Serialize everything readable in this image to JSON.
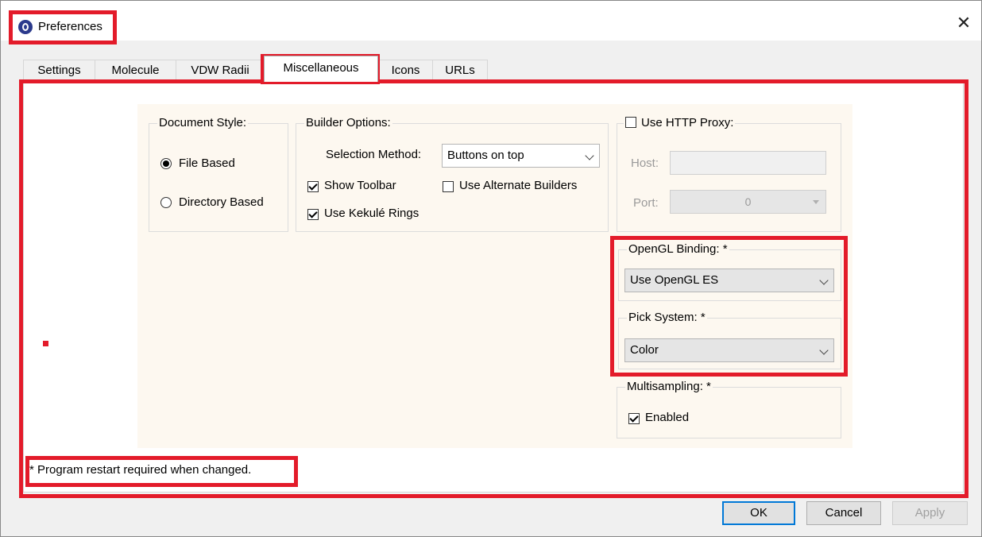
{
  "window": {
    "title": "Preferences",
    "close_glyph": "✕"
  },
  "tabs": [
    {
      "label": "Settings"
    },
    {
      "label": "Molecule"
    },
    {
      "label": "VDW Radii"
    },
    {
      "label": "Miscellaneous",
      "active": true
    },
    {
      "label": "Icons"
    },
    {
      "label": "URLs"
    }
  ],
  "document_style": {
    "title": "Document Style:",
    "options": [
      {
        "label": "File Based",
        "checked": true
      },
      {
        "label": "Directory Based",
        "checked": false
      }
    ]
  },
  "builder_options": {
    "title": "Builder Options:",
    "selection_method_label": "Selection Method:",
    "selection_method_value": "Buttons on top",
    "show_toolbar": {
      "label": "Show Toolbar",
      "checked": true
    },
    "use_alternate_builders": {
      "label": "Use Alternate Builders",
      "checked": false
    },
    "use_kekule_rings": {
      "label": "Use Kekulé Rings",
      "checked": true
    }
  },
  "http_proxy": {
    "title": "Use HTTP Proxy:",
    "checked": false,
    "host_label": "Host:",
    "host_value": "",
    "port_label": "Port:",
    "port_value": "0"
  },
  "opengl_binding": {
    "title": "OpenGL Binding: *",
    "value": "Use OpenGL ES"
  },
  "pick_system": {
    "title": "Pick System: *",
    "value": "Color"
  },
  "multisampling": {
    "title": "Multisampling: *",
    "enabled": {
      "label": "Enabled",
      "checked": true
    }
  },
  "footnote": "* Program restart required when changed.",
  "buttons": {
    "ok": "OK",
    "cancel": "Cancel",
    "apply": "Apply"
  },
  "colors": {
    "highlight": "#e31b2a",
    "inner_background": "#fdf8f0",
    "default_button_border": "#0078d7"
  }
}
